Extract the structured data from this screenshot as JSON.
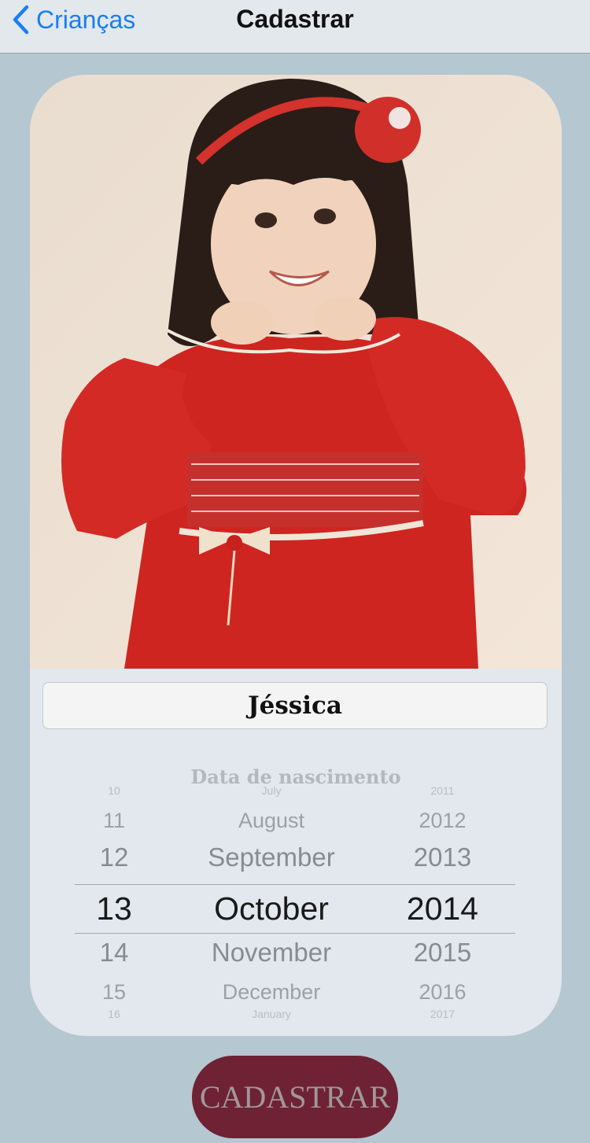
{
  "navbar": {
    "back_label": "Crianças",
    "title": "Cadastrar"
  },
  "card": {
    "photo_icon": "child-photo",
    "name_value": "Jéssica",
    "date_label": "Data de nascimento",
    "date_picker": {
      "rows": [
        {
          "day": "10",
          "month": "July",
          "year": "2011"
        },
        {
          "day": "11",
          "month": "August",
          "year": "2012"
        },
        {
          "day": "12",
          "month": "September",
          "year": "2013"
        },
        {
          "day": "13",
          "month": "October",
          "year": "2014"
        },
        {
          "day": "14",
          "month": "November",
          "year": "2015"
        },
        {
          "day": "15",
          "month": "December",
          "year": "2016"
        },
        {
          "day": "16",
          "month": "January",
          "year": "2017"
        }
      ],
      "selected": {
        "day": "13",
        "month": "October",
        "year": "2014"
      }
    }
  },
  "submit_label": "CADASTRAR",
  "colors": {
    "background": "#b5c7d0",
    "accent": "#1a7ef5",
    "button": "#6f2234"
  }
}
